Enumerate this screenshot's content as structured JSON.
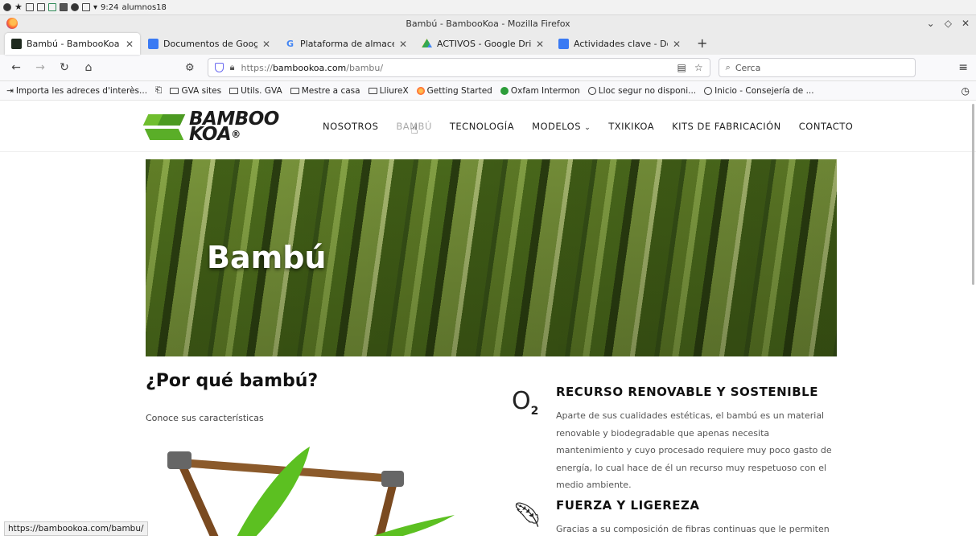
{
  "os_panel": {
    "time": "9:24",
    "user": "alumnos18"
  },
  "window": {
    "title": "Bambú - BambooKoa - Mozilla Firefox"
  },
  "tabs": [
    {
      "label": "Bambú - BambooKoa",
      "favicon": "bambookoa",
      "active": true
    },
    {
      "label": "Documentos de Google",
      "favicon": "google-docs",
      "active": false
    },
    {
      "label": "Plataforma de almacenami",
      "favicon": "google",
      "active": false
    },
    {
      "label": "ACTIVOS - Google Drive",
      "favicon": "google-drive",
      "active": false
    },
    {
      "label": "Actividades clave - Docume",
      "favicon": "google-docs",
      "active": false
    }
  ],
  "urlbar": {
    "proto": "https://",
    "host": "bambookoa.com",
    "path": "/bambu/"
  },
  "search": {
    "placeholder": "Cerca"
  },
  "bookmarks": [
    {
      "label": "Importa les adreces d'interès...",
      "icon": "import"
    },
    {
      "label": "",
      "icon": "bookmark-folder"
    },
    {
      "label": "GVA sites",
      "icon": "folder"
    },
    {
      "label": "Utils. GVA",
      "icon": "folder"
    },
    {
      "label": "Mestre a casa",
      "icon": "folder"
    },
    {
      "label": "LliureX",
      "icon": "folder"
    },
    {
      "label": "Getting Started",
      "icon": "firefox"
    },
    {
      "label": "Oxfam Intermon",
      "icon": "oxfam"
    },
    {
      "label": "Lloc segur no disponi...",
      "icon": "globe"
    },
    {
      "label": "Inicio - Consejería de ...",
      "icon": "globe"
    }
  ],
  "site": {
    "logo_line1": "BAMBOO",
    "logo_line2": "KOA",
    "logo_reg": "®",
    "nav": [
      {
        "label": "NOSOTROS",
        "current": false
      },
      {
        "label": "BAMBÚ",
        "current": true
      },
      {
        "label": "TECNOLOGÍA",
        "current": false
      },
      {
        "label": "MODELOS",
        "current": false,
        "dropdown": true
      },
      {
        "label": "TXIKIKOA",
        "current": false
      },
      {
        "label": "KITS DE FABRICACIÓN",
        "current": false
      },
      {
        "label": "CONTACTO",
        "current": false
      }
    ],
    "hero_title": "Bambú",
    "why_title": "¿Por qué bambú?",
    "why_subtitle": "Conoce sus características",
    "features": [
      {
        "icon": "o2-icon",
        "title": "RECURSO RENOVABLE Y SOSTENIBLE",
        "text": "Aparte de sus cualidades estéticas, el bambú es un material renovable y biodegradable que apenas necesita mantenimiento y cuyo procesado requiere muy poco gasto de energía, lo cual hace de él un recurso muy respetuoso con el medio ambiente."
      },
      {
        "icon": "feather-icon",
        "title": "FUERZA Y LIGEREZA",
        "text": "Gracias a su composición de fibras continuas que le permiten"
      }
    ]
  },
  "status_link": "https://bambookoa.com/bambu/"
}
